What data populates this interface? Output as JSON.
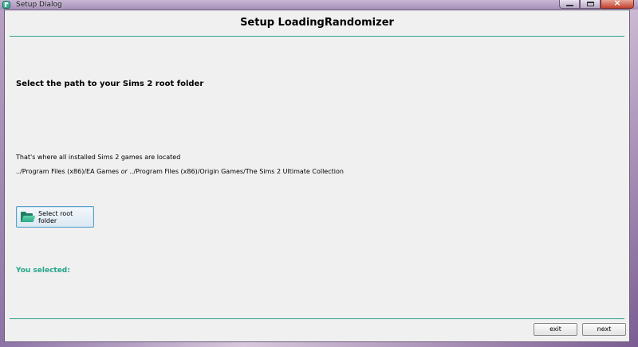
{
  "window": {
    "title": "Setup Dialog",
    "icon": "app-icon",
    "controls": {
      "minimize": "minimize-icon",
      "maximize": "maximize-icon",
      "close": "×"
    }
  },
  "header": {
    "title": "Setup LoadingRandomizer"
  },
  "main": {
    "instruction": "Select the path to your Sims 2 root folder",
    "info_line1": "That's where all installed Sims 2 games are located",
    "info_line2_part1": "../Program Files (x86)/EA Games ",
    "info_line2_or": "or",
    "info_line2_part2": " ../Program Files (x86)/Origin Games/The Sims 2 Ultimate Collection",
    "select_button": {
      "label": "Select root folder",
      "icon": "folder-open-icon"
    },
    "selected_label": "You selected:"
  },
  "footer": {
    "exit_label": "exit",
    "next_label": "next"
  },
  "colors": {
    "accent": "#2aa18a",
    "selected_text": "#23a58a",
    "dialog_bg": "#f0f0f0"
  }
}
